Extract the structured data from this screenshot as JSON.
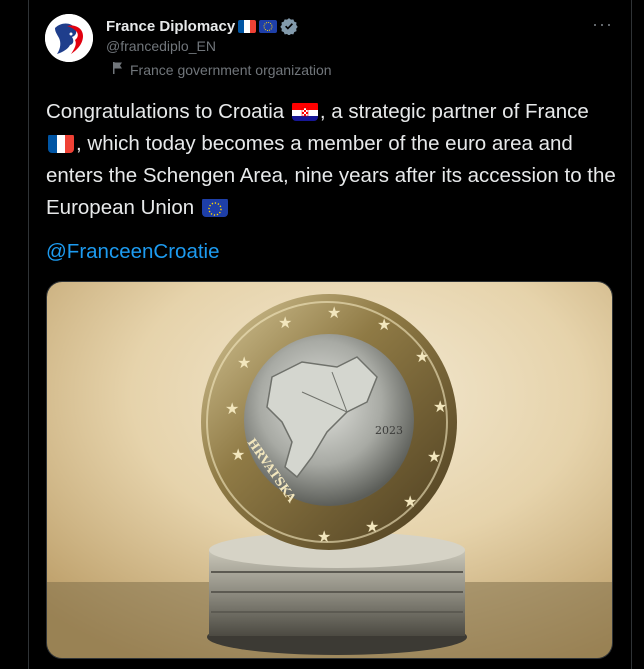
{
  "account": {
    "display_name": "France Diplomacy",
    "handle": "@francediplo_EN",
    "org_label": "France government organization"
  },
  "icons": {
    "flags_in_name": [
      "france-flag-icon",
      "eu-flag-icon"
    ],
    "verified": "verified-badge-icon",
    "org": "flag-icon",
    "more": "more-icon"
  },
  "tweet": {
    "part1": "Congratulations to Croatia",
    "part2": ", a strategic partner of France",
    "part3": ", which today becomes a member of the euro area and enters the Schengen Area, nine years after its accession to the European Union",
    "mention": "@FranceenCroatie"
  },
  "media": {
    "coin_left_text": "HRVATSKA",
    "coin_right_text": "2023"
  },
  "colors": {
    "background": "#000000",
    "text": "#e7e9ea",
    "muted": "#71767b",
    "link": "#1d9bf0",
    "verified": "#829aab"
  }
}
